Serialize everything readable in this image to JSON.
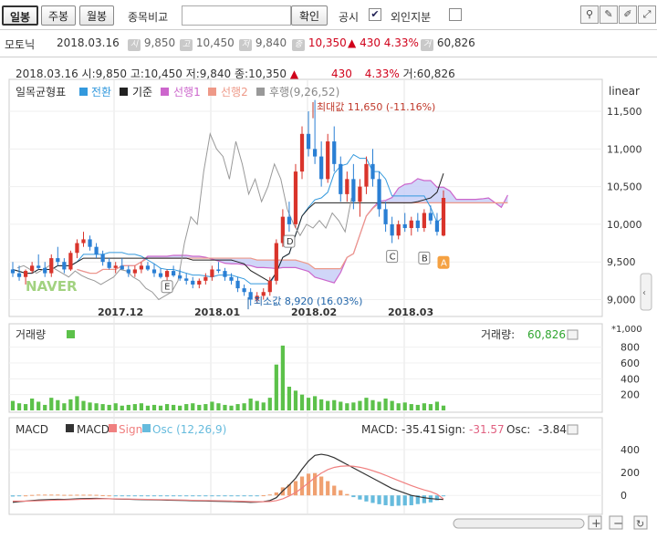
{
  "toolbar": {
    "period_buttons": [
      "일봉",
      "주봉",
      "월봉"
    ],
    "compare_label": "종목비교",
    "compare_input_value": "",
    "confirm_button": "확인",
    "disclosure_label": "공시",
    "foreign_label": "외인지분",
    "disclosure_checked": true,
    "foreign_checked": false
  },
  "quote": {
    "name": "모토닉",
    "date": "2018.03.16",
    "open_label": "시",
    "open": "9,850",
    "high_label": "고",
    "high": "10,450",
    "low_label": "저",
    "low": "9,840",
    "close_label": "종",
    "close": "10,350",
    "change": "430",
    "change_pct": "4.33%",
    "volume_label": "거",
    "volume": "60,826"
  },
  "info_line": {
    "date": "2018.03.16",
    "open": "시:9,850",
    "high": "고:10,450",
    "low": "저:9,840",
    "close": "종:10,350",
    "arrow": "▲",
    "change": "430",
    "pct": "4.33%",
    "volume": "거:60,826"
  },
  "price_panel": {
    "indicator": "일목균형표",
    "legend": [
      {
        "label": "전환",
        "color": "#3399dd"
      },
      {
        "label": "기준",
        "color": "#222222"
      },
      {
        "label": "선행1",
        "color": "#cc66cc"
      },
      {
        "label": "선행2",
        "color": "#ee9988"
      },
      {
        "label": "후행(9,26,52)",
        "color": "#999999"
      }
    ],
    "scale_label": "linear",
    "watermark": "NAVER",
    "max_label": "최대값 11,650 (-11.16%)",
    "min_label": "최소값 8,920 (16.03%)",
    "markers": [
      "D",
      "C",
      "B",
      "A",
      "E"
    ],
    "y_ticks": [
      "11,500",
      "11,000",
      "10,500",
      "10,000",
      "9,500",
      "9,000"
    ],
    "x_ticks": [
      "2017.12",
      "2018.01",
      "2018.02",
      "2018.03"
    ]
  },
  "volume_panel": {
    "title": "거래량",
    "value_label": "거래량:",
    "value": "60,826",
    "unit": "*1,000",
    "y_ticks": [
      "800",
      "600",
      "400",
      "200"
    ]
  },
  "macd_panel": {
    "title": "MACD",
    "legend": [
      {
        "label": "MACD",
        "color": "#333333"
      },
      {
        "label": "Sign",
        "color": "#f08080"
      },
      {
        "label": "Osc (12,26,9)",
        "color": "#66bbdd"
      }
    ],
    "macd_label": "MACD:",
    "macd_value": "-35.41",
    "sign_label": "Sign:",
    "sign_value": "-31.57",
    "osc_label": "Osc:",
    "osc_value": "-3.84",
    "y_ticks": [
      "400",
      "200",
      "0"
    ]
  },
  "chart_data": {
    "type": "candlestick",
    "x_axis_ticks": [
      "2017.12",
      "2018.01",
      "2018.02",
      "2018.03"
    ],
    "price_ylim": [
      8800,
      11900
    ],
    "max_price": 11650,
    "min_price": 8920,
    "last": {
      "date": "2018.03.16",
      "open": 9850,
      "high": 10450,
      "low": 9840,
      "close": 10350,
      "volume": 60826
    },
    "candles": [
      [
        9400,
        9500,
        9300,
        9350
      ],
      [
        9350,
        9450,
        9250,
        9300
      ],
      [
        9300,
        9400,
        9200,
        9380
      ],
      [
        9380,
        9500,
        9350,
        9450
      ],
      [
        9450,
        9600,
        9400,
        9420
      ],
      [
        9420,
        9500,
        9300,
        9350
      ],
      [
        9350,
        9600,
        9300,
        9550
      ],
      [
        9550,
        9700,
        9450,
        9500
      ],
      [
        9500,
        9550,
        9350,
        9400
      ],
      [
        9400,
        9650,
        9380,
        9620
      ],
      [
        9620,
        9800,
        9550,
        9750
      ],
      [
        9750,
        9900,
        9700,
        9800
      ],
      [
        9800,
        9850,
        9650,
        9700
      ],
      [
        9700,
        9750,
        9550,
        9600
      ],
      [
        9600,
        9650,
        9450,
        9500
      ],
      [
        9500,
        9550,
        9400,
        9420
      ],
      [
        9420,
        9500,
        9350,
        9450
      ],
      [
        9450,
        9550,
        9400,
        9400
      ],
      [
        9400,
        9450,
        9300,
        9350
      ],
      [
        9350,
        9450,
        9300,
        9400
      ],
      [
        9400,
        9500,
        9350,
        9450
      ],
      [
        9450,
        9500,
        9380,
        9400
      ],
      [
        9400,
        9480,
        9300,
        9350
      ],
      [
        9350,
        9420,
        9280,
        9300
      ],
      [
        9300,
        9400,
        9250,
        9380
      ],
      [
        9380,
        9450,
        9300,
        9320
      ],
      [
        9320,
        9400,
        9250,
        9280
      ],
      [
        9280,
        9350,
        9200,
        9250
      ],
      [
        9250,
        9300,
        9150,
        9200
      ],
      [
        9200,
        9280,
        9150,
        9250
      ],
      [
        9250,
        9350,
        9200,
        9300
      ],
      [
        9300,
        9450,
        9250,
        9400
      ],
      [
        9400,
        9500,
        9350,
        9380
      ],
      [
        9380,
        9420,
        9250,
        9300
      ],
      [
        9300,
        9350,
        9200,
        9250
      ],
      [
        9250,
        9300,
        9100,
        9150
      ],
      [
        9150,
        9200,
        9050,
        9100
      ],
      [
        9100,
        9150,
        8920,
        9000
      ],
      [
        9000,
        9100,
        8950,
        9050
      ],
      [
        9050,
        9150,
        9000,
        9100
      ],
      [
        9100,
        9300,
        9050,
        9250
      ],
      [
        9250,
        9800,
        9200,
        9750
      ],
      [
        9750,
        10200,
        9700,
        10100
      ],
      [
        10100,
        10300,
        9900,
        10000
      ],
      [
        10000,
        10800,
        9950,
        10700
      ],
      [
        10700,
        11300,
        10600,
        11200
      ],
      [
        11200,
        11500,
        10900,
        11000
      ],
      [
        11000,
        11650,
        10800,
        10900
      ],
      [
        10900,
        11100,
        10500,
        10600
      ],
      [
        10600,
        11200,
        10550,
        11100
      ],
      [
        11100,
        11300,
        10700,
        10800
      ],
      [
        10800,
        10900,
        10300,
        10400
      ],
      [
        10400,
        10700,
        10300,
        10600
      ],
      [
        10600,
        10800,
        10200,
        10300
      ],
      [
        10300,
        10600,
        10100,
        10500
      ],
      [
        10500,
        10900,
        10400,
        10800
      ],
      [
        10800,
        11000,
        10500,
        10600
      ],
      [
        10600,
        10700,
        10100,
        10200
      ],
      [
        10200,
        10300,
        9900,
        10000
      ],
      [
        10000,
        10100,
        9750,
        9850
      ],
      [
        9850,
        10050,
        9800,
        10000
      ],
      [
        10000,
        10150,
        9900,
        9950
      ],
      [
        9950,
        10100,
        9850,
        10050
      ],
      [
        10050,
        10150,
        9900,
        9950
      ],
      [
        9950,
        10200,
        9900,
        10150
      ],
      [
        10150,
        10250,
        10000,
        10050
      ],
      [
        10050,
        10150,
        9850,
        9900
      ],
      [
        9850,
        10450,
        9840,
        10350
      ]
    ],
    "volume": [
      120,
      90,
      80,
      150,
      110,
      70,
      160,
      130,
      90,
      140,
      180,
      120,
      100,
      90,
      80,
      70,
      90,
      60,
      70,
      80,
      90,
      60,
      70,
      60,
      80,
      70,
      60,
      80,
      90,
      70,
      80,
      110,
      90,
      70,
      60,
      80,
      90,
      150,
      120,
      100,
      160,
      580,
      820,
      300,
      250,
      200,
      160,
      180,
      140,
      120,
      130,
      110,
      90,
      100,
      120,
      160,
      130,
      110,
      150,
      120,
      90,
      100,
      80,
      70,
      90,
      80,
      110,
      60.8
    ],
    "macd": [
      -60,
      -55,
      -50,
      -45,
      -40,
      -38,
      -36,
      -34,
      -35,
      -33,
      -30,
      -28,
      -27,
      -26,
      -28,
      -30,
      -32,
      -33,
      -34,
      -36,
      -37,
      -38,
      -39,
      -40,
      -42,
      -43,
      -44,
      -45,
      -47,
      -48,
      -49,
      -50,
      -51,
      -52,
      -53,
      -55,
      -57,
      -60,
      -58,
      -54,
      -45,
      -20,
      40,
      90,
      150,
      230,
      300,
      350,
      360,
      350,
      330,
      300,
      270,
      240,
      210,
      180,
      150,
      120,
      90,
      60,
      40,
      20,
      0,
      -10,
      -20,
      -28,
      -33,
      -35.41
    ],
    "signal": [
      -50,
      -50,
      -50,
      -49,
      -47,
      -45,
      -43,
      -41,
      -40,
      -38,
      -36,
      -34,
      -33,
      -31,
      -30,
      -30,
      -30,
      -31,
      -32,
      -33,
      -34,
      -35,
      -36,
      -37,
      -38,
      -39,
      -40,
      -41,
      -43,
      -44,
      -45,
      -46,
      -47,
      -48,
      -49,
      -50,
      -52,
      -54,
      -55,
      -55,
      -53,
      -46,
      -30,
      -5,
      25,
      65,
      110,
      155,
      195,
      225,
      245,
      255,
      258,
      255,
      246,
      233,
      216,
      197,
      176,
      153,
      130,
      108,
      86,
      66,
      48,
      33,
      10,
      -31.57
    ]
  }
}
